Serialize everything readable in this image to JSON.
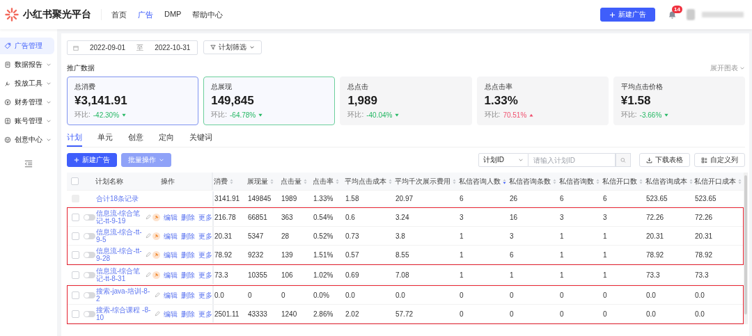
{
  "header": {
    "brand": "小红书聚光平台",
    "nav": [
      {
        "label": "首页",
        "selected": false
      },
      {
        "label": "广告",
        "selected": true
      },
      {
        "label": "DMP",
        "selected": false
      },
      {
        "label": "帮助中心",
        "selected": false
      }
    ],
    "new_button": "新建广告",
    "notifications": "14"
  },
  "sidebar": {
    "items": [
      {
        "label": "广告管理",
        "selected": true,
        "expandable": false
      },
      {
        "label": "数据报告",
        "selected": false,
        "expandable": true
      },
      {
        "label": "投放工具",
        "selected": false,
        "expandable": true
      },
      {
        "label": "财务管理",
        "selected": false,
        "expandable": true
      },
      {
        "label": "账号管理",
        "selected": false,
        "expandable": true
      },
      {
        "label": "创意中心",
        "selected": false,
        "expandable": true
      }
    ]
  },
  "filters": {
    "date_from": "2022-09-01",
    "date_sep": "至",
    "date_to": "2022-10-31",
    "plan_filter": "计划筛选"
  },
  "stats": {
    "title": "推广数据",
    "expand": "展开图表",
    "cards": [
      {
        "label": "总消费",
        "value": "¥3,141.91",
        "change_label": "环比:",
        "change": "-42.30%",
        "rising": false,
        "selected": true,
        "color": "#8094f0"
      },
      {
        "label": "总展现",
        "value": "149,845",
        "change_label": "环比:",
        "change": "-64.78%",
        "rising": false,
        "selected": true,
        "color": "#6ccf9c"
      },
      {
        "label": "总点击",
        "value": "1,989",
        "change_label": "环比:",
        "change": "-40.04%",
        "rising": false,
        "selected": false
      },
      {
        "label": "总点击率",
        "value": "1.33%",
        "change_label": "环比:",
        "change": "70.51%",
        "rising": true,
        "selected": false
      },
      {
        "label": "平均点击价格",
        "value": "¥1.58",
        "change_label": "环比:",
        "change": "-3.66%",
        "rising": false,
        "selected": false
      }
    ]
  },
  "tabs": [
    {
      "label": "计划",
      "selected": true
    },
    {
      "label": "单元",
      "selected": false
    },
    {
      "label": "创意",
      "selected": false
    },
    {
      "label": "定向",
      "selected": false
    },
    {
      "label": "关键词",
      "selected": false
    }
  ],
  "toolbar": {
    "new_button": "新建广告",
    "batch_button": "批量操作",
    "batch_disabled": true,
    "search_type": "计划ID",
    "search_placeholder": "请输入计划ID",
    "download": "下载表格",
    "customize": "自定义列"
  },
  "table": {
    "header_checked": false,
    "columns": [
      {
        "label": "计划名称",
        "sortable": false
      },
      {
        "label": "操作",
        "sortable": false
      },
      {
        "label": "消费",
        "sortable": true,
        "sorted": false
      },
      {
        "label": "展现量",
        "sortable": true,
        "sorted": false
      },
      {
        "label": "点击量",
        "sortable": true,
        "sorted": false
      },
      {
        "label": "点击率",
        "sortable": true,
        "sorted": false
      },
      {
        "label": "平均点击成本",
        "sortable": true,
        "sorted": false
      },
      {
        "label": "平均千次展示费用",
        "sortable": true,
        "sorted": false
      },
      {
        "label": "私信咨询人数",
        "sortable": true,
        "sorted": true
      },
      {
        "label": "私信咨询条数",
        "sortable": true,
        "sorted": false
      },
      {
        "label": "私信咨询数",
        "sortable": true,
        "sorted": false
      },
      {
        "label": "私信开口数",
        "sortable": true,
        "sorted": false
      },
      {
        "label": "私信咨询成本",
        "sortable": true,
        "sorted": false
      },
      {
        "label": "私信开口成本",
        "sortable": true,
        "sorted": false
      }
    ],
    "row_groups": [
      {
        "boxed": false,
        "rows": [
          {
            "kind": "total",
            "name": "合计18条记录",
            "values": [
              "3141.91",
              "149845",
              "1989",
              "1.33%",
              "1.58",
              "20.97",
              "6",
              "26",
              "6",
              "6",
              "523.65",
              "523.65"
            ]
          }
        ]
      },
      {
        "boxed": true,
        "rows": [
          {
            "kind": "plan",
            "checked": false,
            "on": false,
            "name": "信息流-综合笔记-tt-9-19",
            "pinned": true,
            "actions": [
              "编辑",
              "删除",
              "更多"
            ],
            "values": [
              "216.78",
              "66851",
              "363",
              "0.54%",
              "0.6",
              "3.24",
              "3",
              "16",
              "3",
              "3",
              "72.26",
              "72.26"
            ]
          },
          {
            "kind": "plan",
            "checked": false,
            "on": false,
            "name": "信息流-综合-tt-9-5",
            "pinned": true,
            "actions": [
              "编辑",
              "删除",
              "更多"
            ],
            "values": [
              "20.31",
              "5347",
              "28",
              "0.52%",
              "0.73",
              "3.8",
              "1",
              "3",
              "1",
              "1",
              "20.31",
              "20.31"
            ]
          },
          {
            "kind": "plan",
            "checked": false,
            "on": false,
            "name": "信息流-综合-tt-9-28",
            "pinned": true,
            "actions": [
              "编辑",
              "删除",
              "更多"
            ],
            "values": [
              "78.92",
              "9232",
              "139",
              "1.51%",
              "0.57",
              "8.55",
              "1",
              "6",
              "1",
              "1",
              "78.92",
              "78.92"
            ]
          }
        ]
      },
      {
        "boxed": false,
        "rows": [
          {
            "kind": "plan",
            "checked": false,
            "on": false,
            "name": "信息流-综合笔记-tt-8-31",
            "pinned": true,
            "actions": [
              "编辑",
              "删除",
              "更多"
            ],
            "values": [
              "73.3",
              "10355",
              "106",
              "1.02%",
              "0.69",
              "7.08",
              "1",
              "1",
              "1",
              "1",
              "73.3",
              "73.3"
            ]
          }
        ]
      },
      {
        "boxed": true,
        "rows": [
          {
            "kind": "plan",
            "checked": false,
            "on": false,
            "name": "搜索-java-培训-8-2",
            "pinned": false,
            "actions": [
              "编辑",
              "删除",
              "更多"
            ],
            "values": [
              "0.0",
              "0",
              "0",
              "0.0%",
              "0.0",
              "0.0",
              "0",
              "0",
              "0",
              "0",
              "0.0",
              "0.0"
            ]
          },
          {
            "kind": "plan",
            "checked": false,
            "on": false,
            "name": "搜索-综合课程 -8-10",
            "pinned": false,
            "actions": [
              "编辑",
              "删除",
              "更多"
            ],
            "values": [
              "2501.11",
              "43333",
              "1240",
              "2.86%",
              "2.02",
              "57.72",
              "0",
              "0",
              "0",
              "0",
              "0.0",
              "0.0"
            ]
          }
        ]
      }
    ]
  }
}
